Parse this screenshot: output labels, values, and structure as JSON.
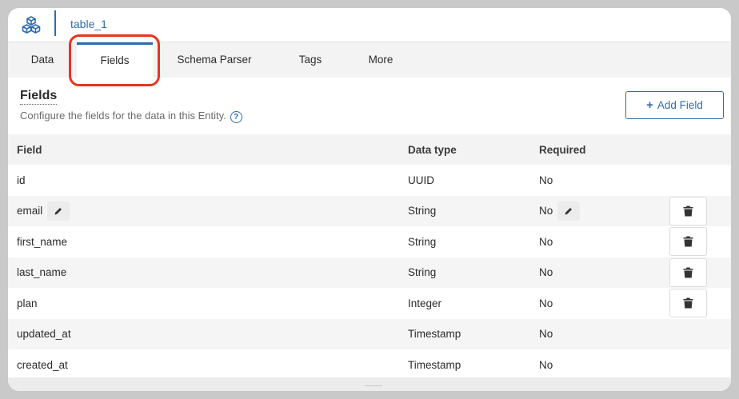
{
  "header": {
    "logo_icon": "cube-stack-icon",
    "entity_name": "table_1"
  },
  "tabs": [
    {
      "label": "Data",
      "active": false
    },
    {
      "label": "Fields",
      "active": true
    },
    {
      "label": "Schema Parser",
      "active": false
    },
    {
      "label": "Tags",
      "active": false
    },
    {
      "label": "More",
      "active": false
    }
  ],
  "section": {
    "title": "Fields",
    "description": "Configure the fields for the data in this Entity.",
    "help_icon": "question-circle-icon",
    "add_button_label": "Add Field"
  },
  "table": {
    "columns": [
      "Field",
      "Data type",
      "Required"
    ],
    "rows": [
      {
        "field": "id",
        "type": "UUID",
        "required": "No",
        "editable": false,
        "deletable": false
      },
      {
        "field": "email",
        "type": "String",
        "required": "No",
        "editable": true,
        "deletable": true
      },
      {
        "field": "first_name",
        "type": "String",
        "required": "No",
        "editable": false,
        "deletable": true
      },
      {
        "field": "last_name",
        "type": "String",
        "required": "No",
        "editable": false,
        "deletable": true
      },
      {
        "field": "plan",
        "type": "Integer",
        "required": "No",
        "editable": false,
        "deletable": true
      },
      {
        "field": "updated_at",
        "type": "Timestamp",
        "required": "No",
        "editable": false,
        "deletable": false
      },
      {
        "field": "created_at",
        "type": "Timestamp",
        "required": "No",
        "editable": false,
        "deletable": false
      }
    ]
  },
  "colors": {
    "accent": "#2e6db0",
    "highlight": "#e8341f"
  }
}
